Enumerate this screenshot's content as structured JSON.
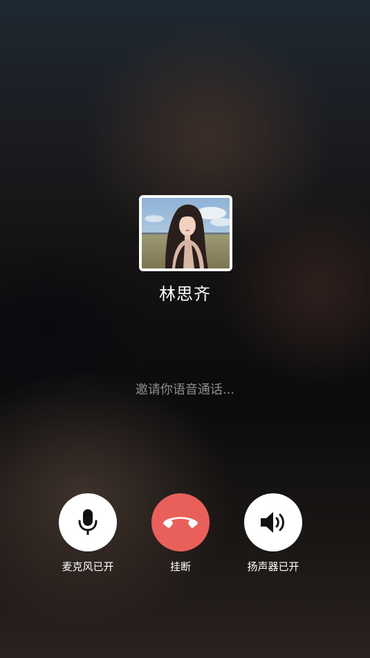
{
  "call": {
    "caller_name": "林思齐",
    "status_text": "邀请你语音通话..."
  },
  "controls": [
    {
      "id": "microphone",
      "label": "麦克风已开",
      "icon": "microphone-icon"
    },
    {
      "id": "hangup",
      "label": "挂断",
      "icon": "phone-hangup-icon"
    },
    {
      "id": "speaker",
      "label": "扬声器已开",
      "icon": "speaker-icon"
    }
  ],
  "colors": {
    "hangup_button": "#e9605a",
    "control_button": "#ffffff",
    "caller_name_text": "#ffffff",
    "status_text": "#8f8f8f"
  }
}
